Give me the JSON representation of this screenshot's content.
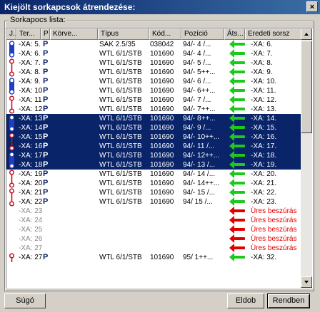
{
  "window": {
    "title": "Kiejölt sorkapcsok átrendezése:",
    "close_label": "×"
  },
  "group": {
    "label": "Sorkapocs lista:"
  },
  "columns": [
    "J...",
    "Ter...",
    "P",
    "Körve...",
    "Típus",
    "Kód...",
    "Pozíció",
    "Áts...",
    "Eredeti sorsz"
  ],
  "rows": [
    {
      "conn": "blue-top",
      "ter": "-XA: 5.",
      "p": "P",
      "tipus": "SAK 2.5/35",
      "kod": "038042",
      "poz": "94/-  4  /...",
      "arrow": "green",
      "ered": "-XA: 6.",
      "sel": false,
      "ter_gray": false
    },
    {
      "conn": "blue-bot",
      "ter": "-XA: 6.",
      "p": "P",
      "tipus": "WTL 6/1/STB",
      "kod": "101690",
      "poz": "94/-  4  /...",
      "arrow": "green",
      "ered": "-XA: 7.",
      "sel": false,
      "ter_gray": false
    },
    {
      "conn": "red-top",
      "ter": "-XA: 7.",
      "p": "P",
      "tipus": "WTL 6/1/STB",
      "kod": "101690",
      "poz": "94/-  5  /...",
      "arrow": "green",
      "ered": "-XA: 8.",
      "sel": false,
      "ter_gray": false
    },
    {
      "conn": "red-bot",
      "ter": "-XA: 8.",
      "p": "P",
      "tipus": "WTL 6/1/STB",
      "kod": "101690",
      "poz": "94/-  5++...",
      "arrow": "green",
      "ered": "-XA: 9.",
      "sel": false,
      "ter_gray": false
    },
    {
      "conn": "blue-top",
      "ter": "-XA: 9.",
      "p": "P",
      "tipus": "WTL 6/1/STB",
      "kod": "101690",
      "poz": "94/-  6  /...",
      "arrow": "green",
      "ered": "-XA: 10.",
      "sel": false,
      "ter_gray": false
    },
    {
      "conn": "blue-bot",
      "ter": "-XA: 10.",
      "p": "P",
      "tipus": "WTL 6/1/STB",
      "kod": "101690",
      "poz": "94/-  6++...",
      "arrow": "green",
      "ered": "-XA: 11.",
      "sel": false,
      "ter_gray": false
    },
    {
      "conn": "red-top",
      "ter": "-XA: 11.",
      "p": "P",
      "tipus": "WTL 6/1/STB",
      "kod": "101690",
      "poz": "94/-  7  /...",
      "arrow": "green",
      "ered": "-XA: 12.",
      "sel": false,
      "ter_gray": false
    },
    {
      "conn": "red-bot",
      "ter": "-XA: 12.",
      "p": "P",
      "tipus": "WTL 6/1/STB",
      "kod": "101690",
      "poz": "94/-  7++...",
      "arrow": "green",
      "ered": "-XA: 13.",
      "sel": false,
      "ter_gray": false
    },
    {
      "conn": "blue-top",
      "ter": "-XA: 13.",
      "p": "P",
      "tipus": "WTL 6/1/STB",
      "kod": "101690",
      "poz": "94/-  8++...",
      "arrow": "green",
      "ered": "-XA: 14.",
      "sel": true,
      "ter_gray": false
    },
    {
      "conn": "blue-bot",
      "ter": "-XA: 14.",
      "p": "P",
      "tipus": "WTL 6/1/STB",
      "kod": "101690",
      "poz": "94/-  9  /...",
      "arrow": "green",
      "ered": "-XA: 15.",
      "sel": true,
      "ter_gray": false
    },
    {
      "conn": "red-top",
      "ter": "-XA: 15.",
      "p": "P",
      "tipus": "WTL 6/1/STB",
      "kod": "101690",
      "poz": "94/- 10++...",
      "arrow": "green",
      "ered": "-XA: 16.",
      "sel": true,
      "ter_gray": false
    },
    {
      "conn": "red-bot",
      "ter": "-XA: 16.",
      "p": "P",
      "tipus": "WTL 6/1/STB",
      "kod": "101690",
      "poz": "94/- 11  /...",
      "arrow": "green",
      "ered": "-XA: 17.",
      "sel": true,
      "ter_gray": false
    },
    {
      "conn": "blue-top",
      "ter": "-XA: 17.",
      "p": "P",
      "tipus": "WTL 6/1/STB",
      "kod": "101690",
      "poz": "94/- 12++...",
      "arrow": "green",
      "ered": "-XA: 18.",
      "sel": true,
      "ter_gray": false
    },
    {
      "conn": "blue-bot",
      "ter": "-XA: 18.",
      "p": "P",
      "tipus": "WTL 6/1/STB",
      "kod": "101690",
      "poz": "94/- 13  /...",
      "arrow": "green",
      "ered": "-XA: 19.",
      "sel": true,
      "ter_gray": false
    },
    {
      "conn": "red-top",
      "ter": "-XA: 19.",
      "p": "P",
      "tipus": "WTL 6/1/STB",
      "kod": "101690",
      "poz": "94/- 14  /...",
      "arrow": "green",
      "ered": "-XA: 20.",
      "sel": false,
      "ter_gray": false
    },
    {
      "conn": "red-bot",
      "ter": "-XA: 20.",
      "p": "P",
      "tipus": "WTL 6/1/STB",
      "kod": "101690",
      "poz": "94/- 14++...",
      "arrow": "green",
      "ered": "-XA: 21.",
      "sel": false,
      "ter_gray": false
    },
    {
      "conn": "red-top",
      "ter": "-XA: 21.",
      "p": "P",
      "tipus": "WTL 6/1/STB",
      "kod": "101690",
      "poz": "94/- 15  /...",
      "arrow": "green",
      "ered": "-XA: 22.",
      "sel": false,
      "ter_gray": false
    },
    {
      "conn": "red-bot",
      "ter": "-XA: 22.",
      "p": "P",
      "tipus": "WTL 6/1/STB",
      "kod": "101690",
      "poz": "94/  15  /...",
      "arrow": "green",
      "ered": "-XA: 23.",
      "sel": false,
      "ter_gray": false
    },
    {
      "conn": "",
      "ter": "-XA: 23.",
      "p": "",
      "tipus": "",
      "kod": "",
      "poz": "",
      "arrow": "red",
      "ered": "Üres beszúrás",
      "sel": false,
      "ter_gray": true
    },
    {
      "conn": "",
      "ter": "-XA: 24.",
      "p": "",
      "tipus": "",
      "kod": "",
      "poz": "",
      "arrow": "red",
      "ered": "Üres beszúrás",
      "sel": false,
      "ter_gray": true
    },
    {
      "conn": "",
      "ter": "-XA: 25.",
      "p": "",
      "tipus": "",
      "kod": "",
      "poz": "",
      "arrow": "red",
      "ered": "Üres beszúrás",
      "sel": false,
      "ter_gray": true
    },
    {
      "conn": "",
      "ter": "-XA: 26.",
      "p": "",
      "tipus": "",
      "kod": "",
      "poz": "",
      "arrow": "red",
      "ered": "Üres beszúrás",
      "sel": false,
      "ter_gray": true
    },
    {
      "conn": "",
      "ter": "-XA: 27.",
      "p": "",
      "tipus": "",
      "kod": "",
      "poz": "",
      "arrow": "red",
      "ered": "Üres beszúrás",
      "sel": false,
      "ter_gray": true
    },
    {
      "conn": "red-top",
      "ter": "-XA: 27.",
      "p": "P",
      "tipus": "WTL 6/1/STB",
      "kod": "101690",
      "poz": "95/  1++...",
      "arrow": "green",
      "ered": "-XA: 32.",
      "sel": false,
      "ter_gray": false
    }
  ],
  "buttons": {
    "help": "Súgó",
    "cancel": "Eldob",
    "ok": "Rendben"
  },
  "colors": {
    "selection": "#0a246a",
    "green_arrow": "#1ec81e",
    "red_arrow": "#e00000",
    "blue_conn": "#1f3fbf",
    "red_conn": "#c01020"
  }
}
